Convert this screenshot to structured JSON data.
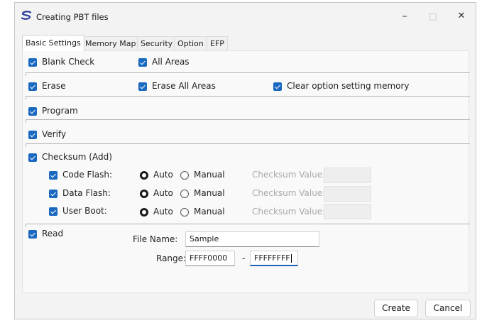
{
  "window": {
    "title": "Creating PBT files",
    "controls": {
      "minimize": "–",
      "maximize": "□",
      "close": "✕"
    }
  },
  "tabs": [
    {
      "label": "Basic Settings",
      "active": true
    },
    {
      "label": "Memory Map",
      "active": false
    },
    {
      "label": "Security",
      "active": false
    },
    {
      "label": "Option",
      "active": false
    },
    {
      "label": "EFP",
      "active": false
    }
  ],
  "blank_check": {
    "label": "Blank Check",
    "checked": true,
    "all_areas_label": "All Areas",
    "all_areas_checked": true
  },
  "erase": {
    "label": "Erase",
    "checked": true,
    "all_areas_label": "Erase All Areas",
    "all_areas_checked": true,
    "clear_option_label": "Clear option setting memory",
    "clear_option_checked": true
  },
  "program": {
    "label": "Program",
    "checked": true
  },
  "verify": {
    "label": "Verify",
    "checked": true
  },
  "checksum": {
    "label": "Checksum (Add)",
    "checked": true,
    "auto_label": "Auto",
    "manual_label": "Manual",
    "value_label": "Checksum Value:",
    "rows": [
      {
        "label": "Code Flash:",
        "checked": true,
        "selected": "Auto",
        "value": ""
      },
      {
        "label": "Data Flash:",
        "checked": true,
        "selected": "Auto",
        "value": ""
      },
      {
        "label": "User Boot:",
        "checked": true,
        "selected": "Auto",
        "value": ""
      }
    ]
  },
  "read": {
    "label": "Read",
    "checked": true,
    "file_name_label": "File Name:",
    "file_name_value": "Sample",
    "range_label": "Range:",
    "range_start": "FFFF0000",
    "range_separator": "-",
    "range_end": "FFFFFFFF"
  },
  "buttons": {
    "create": "Create",
    "cancel": "Cancel"
  },
  "colors": {
    "accent": "#1a69c1",
    "window_bg": "#f3f3f3",
    "panel_bg": "#f9f9f9"
  }
}
